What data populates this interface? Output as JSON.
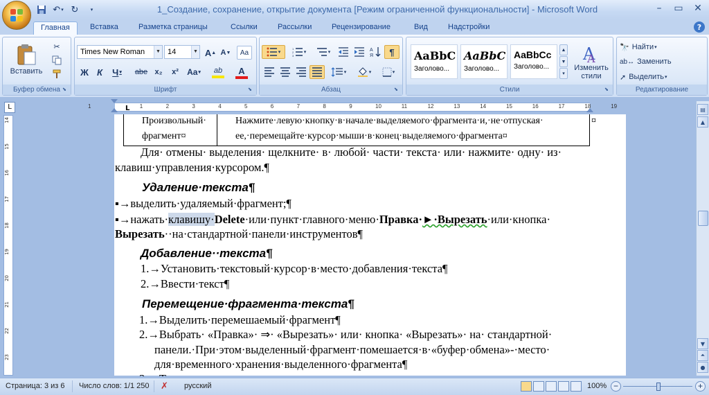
{
  "window": {
    "title": "1_Создание, сохранение, открытие документа [Режим ограниченной функциональности] - Microsoft Word",
    "controls": [
      "–",
      "▭",
      "✕"
    ]
  },
  "quick_access": {
    "save_icon": "save-icon",
    "undo_icon": "undo-icon",
    "redo_icon": "redo-icon",
    "customize_icon": "customize-qat-icon"
  },
  "tabs": [
    "Главная",
    "Вставка",
    "Разметка страницы",
    "Ссылки",
    "Рассылки",
    "Рецензирование",
    "Вид",
    "Надстройки"
  ],
  "active_tab": "Главная",
  "help_label": "?",
  "ribbon": {
    "clipboard": {
      "label": "Буфер обмена",
      "paste_label": "Вставить",
      "cut_icon": "cut-icon",
      "copy_icon": "copy-icon",
      "format_painter_icon": "format-painter-icon"
    },
    "font": {
      "label": "Шрифт",
      "font_name": "Times New Roman",
      "font_size": "14",
      "grow": "A",
      "shrink": "A",
      "clear": "Aa",
      "bold": "Ж",
      "italic": "К",
      "underline": "Ч",
      "strike": "abe",
      "subscript": "x₂",
      "superscript": "x²",
      "change_case": "Aa",
      "highlight": "ab",
      "font_color": "A",
      "font_color_hex": "#e31b1b",
      "highlight_hex": "#f7e600"
    },
    "paragraph": {
      "label": "Абзац"
    },
    "styles": {
      "label": "Стили",
      "items": [
        {
          "preview": "AaBbC",
          "name": "Заголово..."
        },
        {
          "preview": "AaBbC",
          "name": "Заголово..."
        },
        {
          "preview": "AaBbCc",
          "name": "Заголово..."
        }
      ],
      "change_label": "Изменить стили"
    },
    "editing": {
      "label": "Редактирование",
      "find": "Найти",
      "replace": "Заменить",
      "select": "Выделить"
    }
  },
  "ruler": {
    "h_ticks": [
      "1",
      "1",
      "2",
      "3",
      "4",
      "5",
      "6",
      "7",
      "8",
      "9",
      "10",
      "11",
      "12",
      "13",
      "14",
      "15",
      "16",
      "17",
      "18",
      "19"
    ],
    "v_ticks": [
      "14",
      "15",
      "16",
      "17",
      "18",
      "19",
      "20",
      "21",
      "22",
      "23"
    ]
  },
  "document": {
    "table_cell1_line1": "Произвольный·",
    "table_cell1_line2": "фрагмент¤",
    "table_cell2_line1": "Нажмите·левую·кнопку·в·начале·выделяемого·фрагмента·и,·не·отпуская·",
    "table_cell2_line2": "ее,·перемещайте·курсор·мыши·в·конец·выделяемого·фрагмента¤",
    "table_end_mark": "¤",
    "para1_line1": "Для· отмены· выделения· щелкните· в· любой· части· текста· или· нажмите· одну· из·",
    "para1_line2": "клавиш·управления·курсором.¶",
    "h_delete": "Удаление·текста¶",
    "del_item1": "▪→выделить·удаляемый·фрагмент;¶",
    "del_item2_a": "▪→нажать·",
    "del_item2_sel": "клавишу·",
    "del_item2_b": "Delete",
    "del_item2_c": "·или·пункт·главного·меню·",
    "del_item2_d": "Правка·",
    "del_item2_e": "►·Вырезать",
    "del_item2_f": "·или·кнопка·",
    "del_item2_line2_a": "Вырезать",
    "del_item2_line2_b": "··на·стандартной·панели·инструментов¶",
    "h_add": "Добавление··текста¶",
    "add_item1": "1.→Установить·текстовый·курсор·в·место·добавления·текста¶",
    "add_item2": "2.→Ввести·текст¶",
    "h_move": "Перемещение·фрагмента·текста¶",
    "move_item1": "1.→Выделить·перемешаемый·фрагмент¶",
    "move_item2_line1": "2.→Выбрать· «Правка»· ⇒· «Вырезать»· или· кнопка· «Вырезать»· на· стандартной·",
    "move_item2_line2": "панели.·При·этом·выделенный·фрагмент·помешается·в·«буфер·обмена»-·место·",
    "move_item2_line3": "для·временного·хранения·выделенного·фрагмента¶",
    "move_item3_partial": "3.→Т"
  },
  "status": {
    "page": "Страница: 3 из 6",
    "words": "Число слов: 1/1 250",
    "language": "русский",
    "zoom": "100%"
  }
}
